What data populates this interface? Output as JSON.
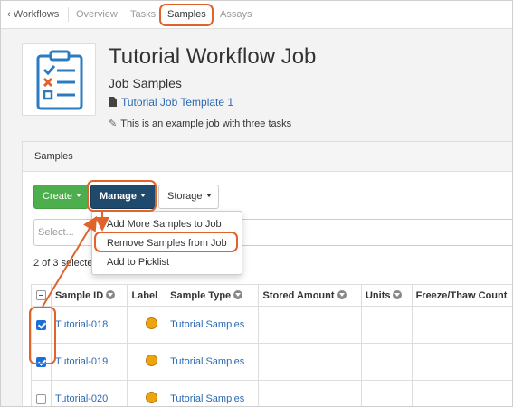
{
  "nav": {
    "back_label": "Workflows",
    "tabs": [
      {
        "label": "Overview"
      },
      {
        "label": "Tasks"
      },
      {
        "label": "Samples"
      },
      {
        "label": "Assays"
      }
    ]
  },
  "header": {
    "title": "Tutorial Workflow Job",
    "subtitle": "Job Samples",
    "template_link": "Tutorial Job Template 1",
    "description": "This is an example job with three tasks"
  },
  "panel": {
    "title": "Samples",
    "buttons": {
      "create": "Create",
      "manage": "Manage",
      "storage": "Storage"
    },
    "filter_placeholder": "Select...",
    "selected_count": "2 of 3 selecte",
    "menu": [
      {
        "label": "Add More Samples to Job"
      },
      {
        "label": "Remove Samples from Job"
      },
      {
        "label": "Add to Picklist"
      }
    ],
    "table": {
      "columns": [
        "Sample ID",
        "Label",
        "Sample Type",
        "Stored Amount",
        "Units",
        "Freeze/Thaw Count"
      ],
      "rows": [
        {
          "checked": true,
          "sample_id": "Tutorial-018",
          "label_color": "#f0a30a",
          "sample_type": "Tutorial Samples"
        },
        {
          "checked": true,
          "sample_id": "Tutorial-019",
          "label_color": "#f0a30a",
          "sample_type": "Tutorial Samples"
        },
        {
          "checked": false,
          "sample_id": "Tutorial-020",
          "label_color": "#f0a30a",
          "sample_type": "Tutorial Samples"
        }
      ]
    }
  },
  "colors": {
    "accent_callout": "#e0632c",
    "create_button": "#4cae4c",
    "manage_button": "#1f4a6e",
    "link": "#2a6ab3",
    "label_dot": "#f0a30a"
  },
  "icons": {
    "back": "chevron-left-icon",
    "logo": "clipboard-checklist-icon",
    "template": "document-icon",
    "description": "pencil-edit-icon",
    "column_menu": "chevron-circle-down-icon"
  }
}
